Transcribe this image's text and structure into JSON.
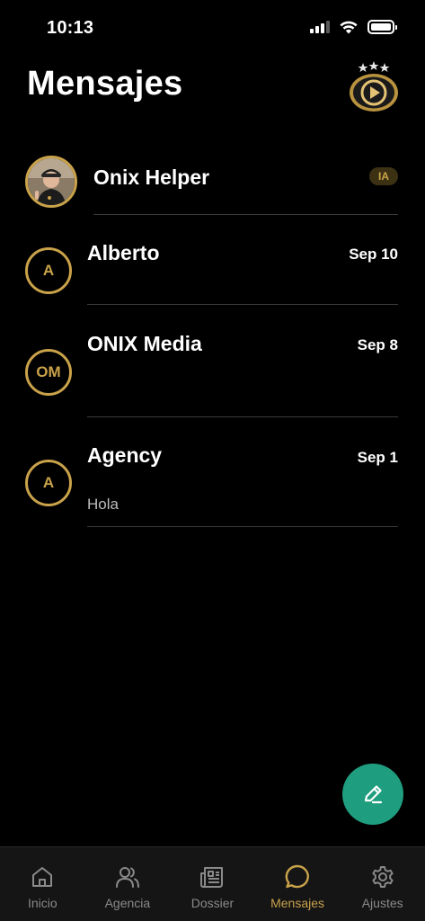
{
  "status_bar": {
    "time": "10:13"
  },
  "header": {
    "title": "Mensajes"
  },
  "conversations": [
    {
      "name": "Onix Helper",
      "badge": "IA",
      "date": "",
      "preview": "",
      "avatar_type": "photo",
      "initials": ""
    },
    {
      "name": "Alberto",
      "date": "Sep 10",
      "preview": "",
      "avatar_type": "initials",
      "initials": "A"
    },
    {
      "name": "ONIX Media",
      "date": "Sep 8",
      "preview": "",
      "avatar_type": "initials",
      "initials": "OM"
    },
    {
      "name": "Agency",
      "date": "Sep 1",
      "preview": "Hola",
      "avatar_type": "initials",
      "initials": "A"
    }
  ],
  "tabs": [
    {
      "label": "Inicio",
      "icon": "home-icon",
      "active": false
    },
    {
      "label": "Agencia",
      "icon": "users-icon",
      "active": false
    },
    {
      "label": "Dossier",
      "icon": "newspaper-icon",
      "active": false
    },
    {
      "label": "Mensajes",
      "icon": "chat-bubble-icon",
      "active": true
    },
    {
      "label": "Ajustes",
      "icon": "gear-icon",
      "active": false
    }
  ],
  "colors": {
    "accent": "#c9a24a",
    "fab": "#1f9e7f",
    "background": "#000000",
    "tab_bar": "#151515"
  }
}
